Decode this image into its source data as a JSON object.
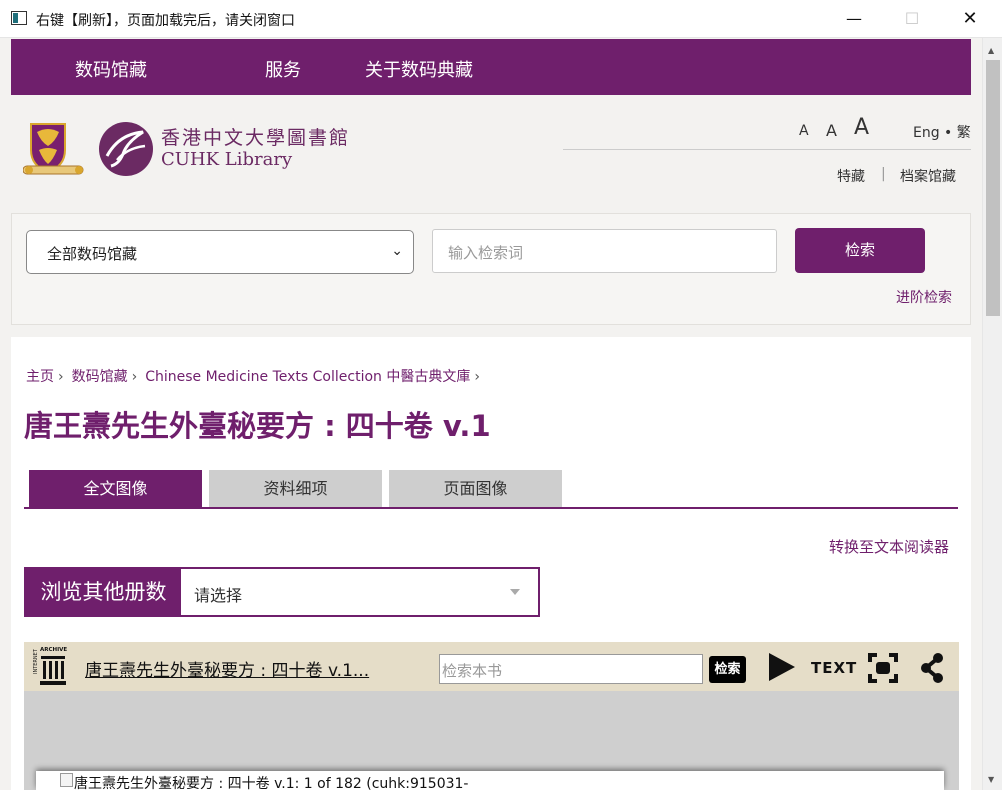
{
  "window": {
    "title": "右键【刷新】，页面加载完后，请关闭窗口",
    "min_glyph": "—",
    "max_glyph": "☐",
    "close_glyph": "✕"
  },
  "scrollbar": {
    "up_glyph": "▲",
    "down_glyph": "▼"
  },
  "nav": {
    "items": [
      "数码馆藏",
      "服务",
      "关于数码典藏"
    ]
  },
  "header": {
    "logo_cn": "香港中文大學圖書館",
    "logo_en": "CUHK Library",
    "font_small": "A",
    "font_medium": "A",
    "font_large": "A",
    "lang": "Eng • 繁",
    "special_collections": "特藏",
    "separator": "|",
    "archives": "档案馆藏"
  },
  "search": {
    "collection_value": "全部数码馆藏",
    "chevron": "⌄",
    "placeholder": "输入检索词",
    "button": "检索",
    "advanced": "进阶检索"
  },
  "breadcrumb": [
    "主页",
    "数码馆藏",
    "Chinese Medicine Texts Collection 中醫古典文庫"
  ],
  "breadcrumb_sep": "›",
  "title": "唐王燾先生外臺秘要方 : 四十卷 v.1",
  "tabs": [
    "全文图像",
    "资料细项",
    "页面图像"
  ],
  "text_reader": "转换至文本阅读器",
  "volume": {
    "label": "浏览其他册数",
    "placeholder": "请选择"
  },
  "viewer": {
    "title": "唐王燾先生外臺秘要方 : 四十卷 v.1...",
    "search_placeholder": "检索本书",
    "search_button": "检索",
    "text_button": "TEXT",
    "page_alt": "唐王燾先生外臺秘要方 : 四十卷 v.1: 1 of 182 (cuhk:915031-"
  },
  "colors": {
    "brand_purple": "#6f1f6c",
    "viewer_bar": "#e5ddc8",
    "tab_inactive": "#cecece"
  },
  "icons": [
    "app-window-icon",
    "cuhk-crest-icon",
    "library-emblem-icon",
    "internet-archive-icon",
    "play-icon",
    "fullscreen-icon",
    "share-icon",
    "broken-image-icon"
  ]
}
